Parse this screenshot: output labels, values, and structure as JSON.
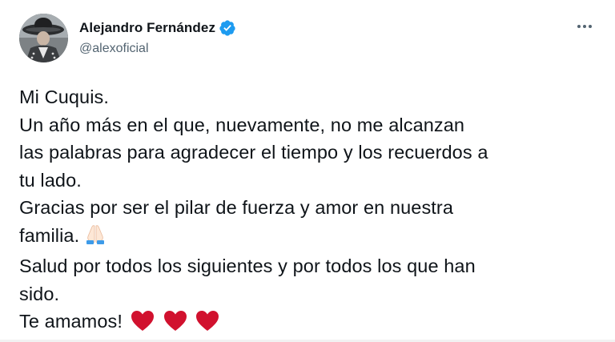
{
  "author": {
    "display_name": "Alejandro Fernández",
    "handle": "@alexoficial",
    "verified": true,
    "verified_color": "#1d9bf0"
  },
  "tweet": {
    "lines": [
      "Mi Cuquis.",
      "Un año más en el que, nuevamente, no me alcanzan",
      "las palabras para agradecer el tiempo y los recuerdos a",
      "tu lado.",
      "Gracias por ser el pilar de fuerza y amor en nuestra",
      "familia.",
      "Salud por todos los siguientes y por todos los que han",
      "sido.",
      "Te amamos!"
    ],
    "emoji_after_familia": "folded-hands-emoji",
    "hearts_count": 3,
    "heart_color": "#d1112e"
  },
  "icons": {
    "more": "more-options-icon",
    "verified": "verified-badge-icon"
  }
}
